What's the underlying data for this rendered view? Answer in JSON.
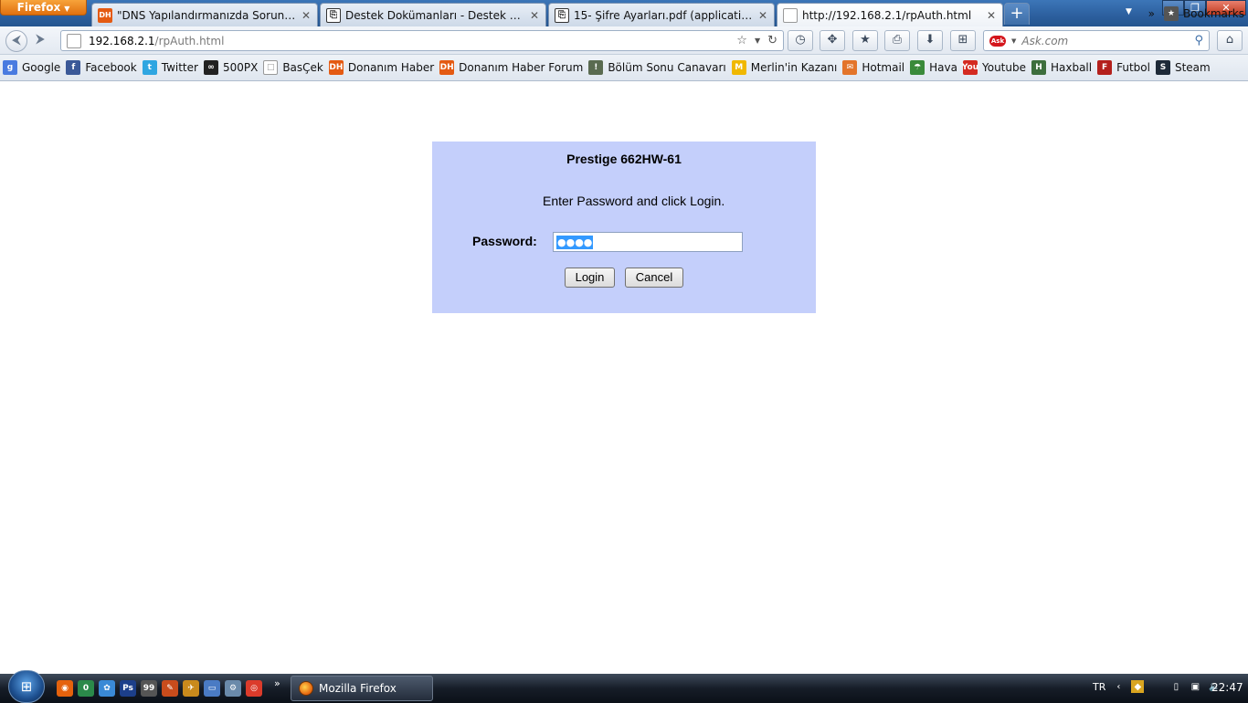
{
  "browser": {
    "menu_label": "Firefox",
    "tabs": [
      {
        "label": "\"DNS Yapılandırmanızda Sorun Olabil...",
        "favicon": "DH"
      },
      {
        "label": "Destek Dokümanları - Destek - AirTie...",
        "favicon": "doc-icon"
      },
      {
        "label": "15- Şifre Ayarları.pdf (application/pdf...",
        "favicon": "doc-icon"
      },
      {
        "label": "http://192.168.2.1/rpAuth.html",
        "favicon": "page-icon"
      }
    ],
    "new_tab": "+",
    "window_buttons": {
      "minimize": "▁",
      "maximize": "❐",
      "close": "✕"
    }
  },
  "navbar": {
    "url_host": "192.168.2.1",
    "url_path": "/rpAuth.html",
    "search_placeholder": "Ask.com",
    "search_logo": "Ask"
  },
  "bookmarks": {
    "items": [
      {
        "label": "Google",
        "icon": "g",
        "color": "#4a7be0"
      },
      {
        "label": "Facebook",
        "icon": "f",
        "color": "#3b5998"
      },
      {
        "label": "Twitter",
        "icon": "t",
        "color": "#2fa6e1"
      },
      {
        "label": "500PX",
        "icon": "∞",
        "color": "#222222"
      },
      {
        "label": "BasÇek",
        "icon": "□",
        "color": "#ffffff"
      },
      {
        "label": "Donanım Haber",
        "icon": "DH",
        "color": "#e45a12"
      },
      {
        "label": "Donanım Haber Forum",
        "icon": "DH",
        "color": "#e45a12"
      },
      {
        "label": "Bölüm Sonu Canavarı",
        "icon": "ǃ",
        "color": "#5a6b50"
      },
      {
        "label": "Merlin'in Kazanı",
        "icon": "M",
        "color": "#f0b800"
      },
      {
        "label": "Hotmail",
        "icon": "✉",
        "color": "#e3742a"
      },
      {
        "label": "Hava",
        "icon": "☂",
        "color": "#3a8a3a"
      },
      {
        "label": "Youtube",
        "icon": "You",
        "color": "#d42a20"
      },
      {
        "label": "Haxball",
        "icon": "H",
        "color": "#3d6e3d"
      },
      {
        "label": "Futbol",
        "icon": "F",
        "color": "#b4201c"
      },
      {
        "label": "Steam",
        "icon": "S",
        "color": "#1e2a38"
      }
    ],
    "overflow": "»",
    "bookmarks_label": "Bookmarks"
  },
  "login": {
    "title": "Prestige 662HW-61",
    "prompt": "Enter Password and click Login.",
    "password_label": "Password:",
    "password_value": "●●●●",
    "login_button": "Login",
    "cancel_button": "Cancel"
  },
  "taskbar": {
    "active_window": "Mozilla Firefox",
    "language": "TR",
    "time": "22:47",
    "more": "»"
  }
}
